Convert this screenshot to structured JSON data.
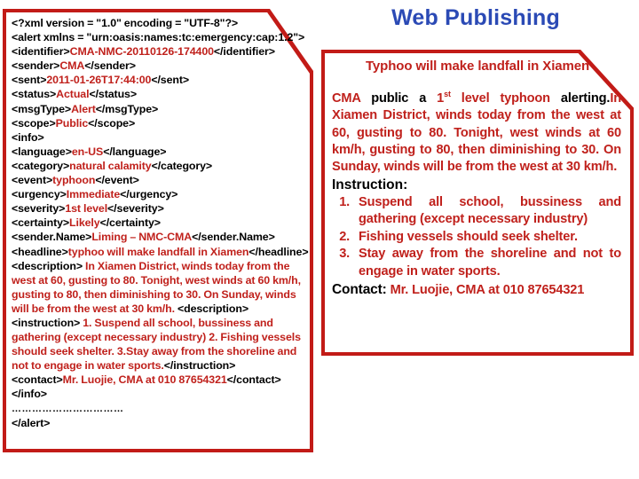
{
  "colors": {
    "red": "#c0211c",
    "frame_red": "#c21b17",
    "blue": "#2b4ab5",
    "black": "#000000",
    "background": "#ffffff"
  },
  "web_publishing": {
    "title": "Web Publishing"
  },
  "xml_panel": {
    "lines": [
      {
        "tag_open": "<?xml version = \"1.0\" encoding = \"UTF-8\"?>",
        "value": "",
        "tag_close": ""
      },
      {
        "tag_open": "<alert xmlns = \"urn:oasis:names:tc:emergency:cap:1.2\">",
        "value": "",
        "tag_close": ""
      },
      {
        "tag_open": "<identifier>",
        "value": "CMA-NMC-20110126-174400",
        "tag_close": "</identifier>"
      },
      {
        "tag_open": "<sender>",
        "value": "CMA",
        "tag_close": "</sender>"
      },
      {
        "tag_open": "<sent>",
        "value": "2011-01-26T17:44:00",
        "tag_close": "</sent>"
      },
      {
        "tag_open": "<status>",
        "value": "Actual",
        "tag_close": "</status>"
      },
      {
        "tag_open": "<msgType>",
        "value": "Alert",
        "tag_close": "</msgType>"
      },
      {
        "tag_open": "<scope>",
        "value": "Public",
        "tag_close": "</scope>"
      },
      {
        "tag_open": "<info>",
        "value": "",
        "tag_close": ""
      },
      {
        "tag_open": "<language>",
        "value": "en-US",
        "tag_close": "</language>"
      },
      {
        "tag_open": "<category>",
        "value": "natural calamity",
        "tag_close": "</category>"
      },
      {
        "tag_open": "<event>",
        "value": "typhoon",
        "tag_close": "</event>"
      },
      {
        "tag_open": "<urgency>",
        "value": "Immediate",
        "tag_close": "</urgency>"
      },
      {
        "tag_open": "<severity>",
        "value": "1st level",
        "tag_close": "</severity>"
      },
      {
        "tag_open": "<certainty>",
        "value": "Likely",
        "tag_close": "</certainty>"
      },
      {
        "tag_open": "<sender.Name>",
        "value": "Liming – NMC-CMA",
        "tag_close": "</sender.Name>"
      },
      {
        "tag_open": "<headline>",
        "value": "typhoo will make landfall in Xiamen",
        "tag_close": "</headline>"
      }
    ],
    "description": {
      "tag_open": "<description>",
      "value": " In Xiamen District, winds today from the west at 60, gusting to 80. Tonight, west winds at 60 km/h, gusting to 80, then diminishing to 30. On Sunday, winds will be from the west at 30 km/h. ",
      "tag_close": "<description>"
    },
    "instruction": {
      "tag_open": "<instruction>",
      "value": " 1. Suspend all school, bussiness and gathering (except necessary industry) 2. Fishing vessels should seek shelter. 3.Stay away from the shoreline and not to engage in water sports.",
      "tag_close": "</instruction>"
    },
    "contact": {
      "tag_open": "<contact>",
      "value": "Mr. Luojie, CMA at 010 87654321",
      "tag_close": "</contact>"
    },
    "closing": {
      "info_close": "</info>",
      "dots": "……………………………",
      "alert_close": "</alert>"
    }
  },
  "alert_panel": {
    "headline": "Typhoo will make landfall in Xiamen",
    "description": {
      "seg1_red": "CMA",
      "seg2_black": " public a ",
      "seg3_red": "1",
      "seg3_sup": "st",
      "seg4_red": " level typhoon",
      "seg5_black": " alerting.",
      "seg6_red": "In Xiamen District, winds today from the west at 60, gusting to 80. Tonight, west winds at 60 km/h, gusting to 80, then diminishing to 30. On Sunday, winds will be from the west at 30 km/h."
    },
    "instruction_label": "Instruction:",
    "instructions": [
      "Suspend all school, bussiness and gathering (except necessary industry)",
      "Fishing vessels should seek shelter.",
      "Stay away from the shoreline and not to engage in water sports."
    ],
    "contact_label": "Contact:",
    "contact_value": "Mr. Luojie, CMA at 010 87654321"
  }
}
